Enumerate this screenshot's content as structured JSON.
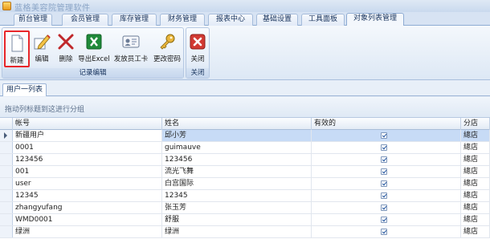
{
  "window": {
    "title": "蓝格美容院管理软件"
  },
  "menu_tabs": [
    "前台管理",
    "会员管理",
    "库存管理",
    "财务管理",
    "报表中心",
    "基础设置",
    "工具面板",
    "对象列表管理"
  ],
  "active_tab": "对象列表管理",
  "ribbon": {
    "record_group": {
      "label": "记录编辑",
      "buttons": [
        {
          "label": "新建",
          "icon": "new-document-icon"
        },
        {
          "label": "编辑",
          "icon": "edit-pencil-icon"
        },
        {
          "label": "删除",
          "icon": "delete-x-icon"
        },
        {
          "label": "导出Excel",
          "icon": "excel-icon"
        },
        {
          "label": "发放员工卡",
          "icon": "id-card-icon"
        },
        {
          "label": "更改密码",
          "icon": "key-icon"
        }
      ]
    },
    "close_group": {
      "label": "关闭",
      "buttons": [
        {
          "label": "关闭",
          "icon": "close-icon"
        }
      ]
    },
    "highlighted_button": "新建",
    "highlight_color": "#e8262a"
  },
  "subtab": {
    "label": "用户一列表"
  },
  "group_hint": "拖动列标题到这进行分组",
  "grid": {
    "columns": [
      "帐号",
      "姓名",
      "有效的",
      "分店"
    ],
    "rows": [
      {
        "account": "新疆用户",
        "name": "邱小芳",
        "valid": true,
        "branch": "總店",
        "selected": true
      },
      {
        "account": "0001",
        "name": "guimauve",
        "valid": true,
        "branch": "總店"
      },
      {
        "account": "123456",
        "name": "123456",
        "valid": true,
        "branch": "總店"
      },
      {
        "account": "001",
        "name": "流光飞舞",
        "valid": true,
        "branch": "總店"
      },
      {
        "account": "user",
        "name": "白宫国际",
        "valid": true,
        "branch": "總店"
      },
      {
        "account": "12345",
        "name": "12345",
        "valid": true,
        "branch": "總店"
      },
      {
        "account": "zhangyufang",
        "name": "张玉芳",
        "valid": true,
        "branch": "總店"
      },
      {
        "account": "WMD0001",
        "name": "舒服",
        "valid": true,
        "branch": "總店"
      },
      {
        "account": "绿洲",
        "name": "绿洲",
        "valid": true,
        "branch": "總店"
      }
    ]
  }
}
